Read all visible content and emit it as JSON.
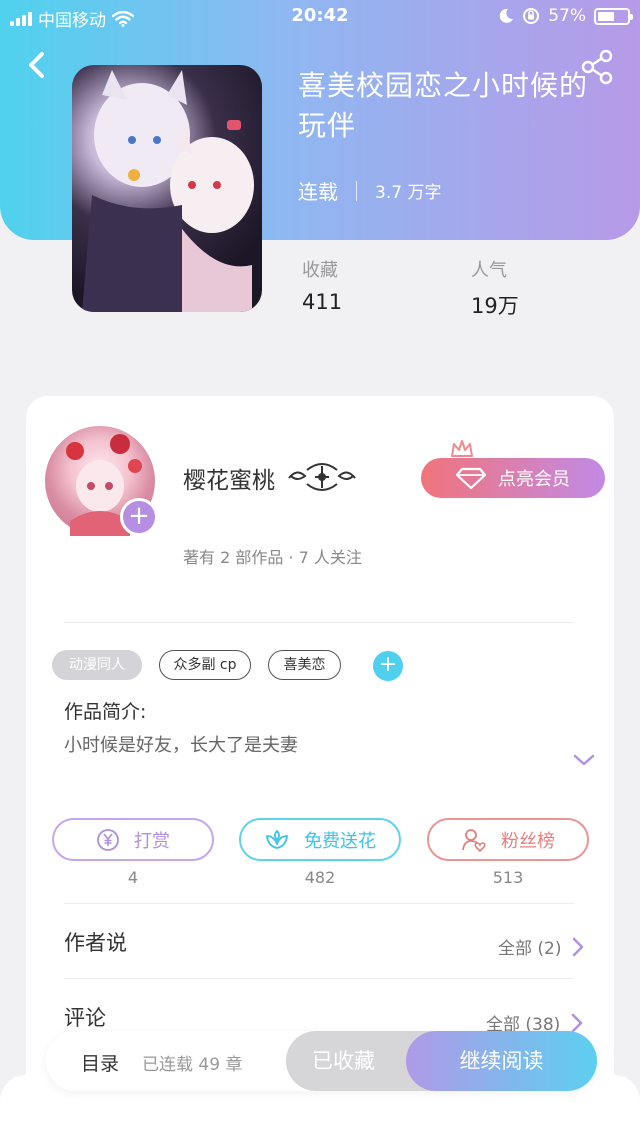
{
  "status_bar": {
    "carrier": "中国移动",
    "time": "20:42",
    "battery": "57%",
    "battery_level": 0.57
  },
  "book": {
    "title": "喜美校园恋之小时候的玩伴",
    "status": "连载",
    "word_count": "3.7 万字",
    "favorites_label": "收藏",
    "favorites_value": "411",
    "popularity_label": "人气",
    "popularity_value": "19万"
  },
  "author": {
    "name": "樱花蜜桃",
    "subtitle": "著有 2 部作品 · 7 人关注",
    "vip_button": "点亮会员"
  },
  "tags": [
    "动漫同人",
    "众多副 cp",
    "喜美恋"
  ],
  "intro": {
    "title": "作品简介:",
    "text": "小时候是好友，长大了是夫妻"
  },
  "actions": [
    {
      "label": "打赏",
      "count": "4",
      "icon": "yen-coin-icon"
    },
    {
      "label": "免费送花",
      "count": "482",
      "icon": "flower-icon"
    },
    {
      "label": "粉丝榜",
      "count": "513",
      "icon": "fan-ranking-icon"
    }
  ],
  "sections": {
    "author_says": {
      "title": "作者说",
      "more": "全部 (2)"
    },
    "comments": {
      "title": "评论",
      "more": "全部 (38)"
    }
  },
  "bottom_bar": {
    "toc_label": "目录",
    "toc_sub": "已连载 49 章",
    "collected_label": "已收藏",
    "read_label": "继续阅读"
  },
  "colors": {
    "header_gradient_start": "#4fd2ee",
    "header_gradient_end": "#b79ae8",
    "vip_gradient_start": "#f1747b",
    "vip_gradient_end": "#c18ae6",
    "accent_purple": "#b08ee0",
    "accent_cyan": "#3ec3e8",
    "accent_red": "#e57f7f"
  }
}
